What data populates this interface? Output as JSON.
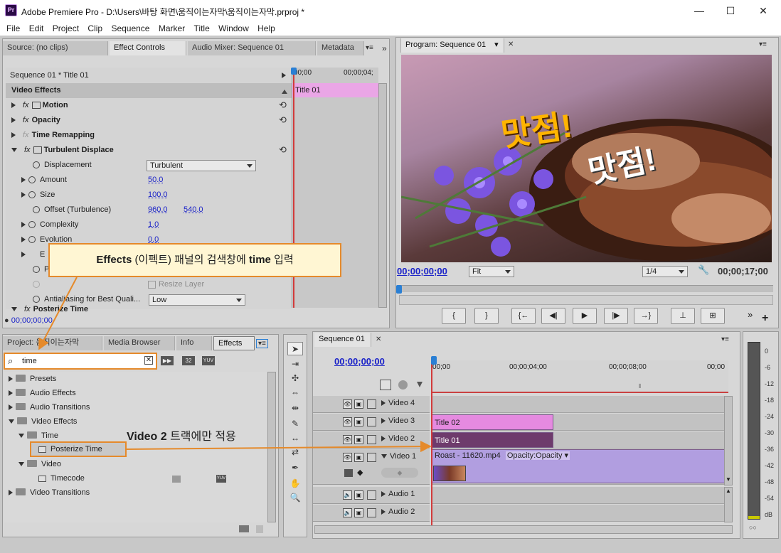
{
  "window": {
    "title": "Adobe Premiere Pro - D:\\Users\\바탕 화면\\움직이는자막\\움직이는자막.prproj *",
    "icon_text": "Pr",
    "minimize": "—",
    "maximize": "☐",
    "close": "✕"
  },
  "menu": [
    "File",
    "Edit",
    "Project",
    "Clip",
    "Sequence",
    "Marker",
    "Title",
    "Window",
    "Help"
  ],
  "top_left_panel": {
    "tabs": [
      "Source: (no clips)",
      "Effect Controls",
      "Audio Mixer: Sequence 01",
      "Metadata"
    ],
    "menu_glyph": "▾≡",
    "overflow_glyph": "»",
    "sequence_label": "Sequence 01 * Title 01",
    "timecode_start": "00;00",
    "timecode_end": "00;00;04;",
    "clip_label": "Title 01",
    "video_effects_header": "Video Effects",
    "fx_glyph": "fx",
    "reset_glyph": "⟲",
    "effects": [
      {
        "name": "Motion"
      },
      {
        "name": "Opacity"
      },
      {
        "name": "Time Remapping"
      },
      {
        "name": "Turbulent Displace"
      }
    ],
    "params": {
      "displacement_label": "Displacement",
      "displacement_value": "Turbulent",
      "amount_label": "Amount",
      "amount_value": "50.0",
      "size_label": "Size",
      "size_value": "100.0",
      "offset_label": "Offset (Turbulence)",
      "offset_x": "960.0",
      "offset_y": "540.0",
      "complexity_label": "Complexity",
      "complexity_value": "1.0",
      "evolution_label": "Evolution",
      "evolution_value": "0.0",
      "e_stub": "E",
      "p_stub": "P",
      "resize_layer": "Resize Layer",
      "antialiasing_label": "Antialiasing for Best Quali...",
      "antialiasing_value": "Low"
    },
    "posterize_label": "Posterize Time",
    "footer_timecode": "00;00;00;00"
  },
  "program_monitor": {
    "tab": "Program: Sequence 01",
    "tab_dropdown": "▾",
    "tab_close": "✕",
    "menu_glyph": "▾≡",
    "overlay_text_1": "맛점!",
    "overlay_text_2": "맛점!",
    "timecode_current": "00;00;00;00",
    "fit": "Fit",
    "resolution": "1/4",
    "wrench": "🔧",
    "timecode_duration": "00;00;17;00",
    "buttons": [
      "{",
      "}",
      "{←",
      "◀|",
      "▶",
      "|▶",
      "→}",
      "⊥",
      "⊞"
    ],
    "extra_glyph": "»",
    "add_glyph": "+"
  },
  "effects_panel": {
    "tabs": [
      "Project: 움직이는자막",
      "Media Browser",
      "Info",
      "Effects"
    ],
    "menu_glyph": "▾≡",
    "search_icon_glyph": "⌕",
    "clear_glyph": "✕",
    "search_value": "time",
    "badges": [
      "32",
      "YUV"
    ],
    "tree": [
      {
        "label": "Presets",
        "level": 0,
        "expanded": false
      },
      {
        "label": "Audio Effects",
        "level": 0,
        "expanded": false
      },
      {
        "label": "Audio Transitions",
        "level": 0,
        "expanded": false
      },
      {
        "label": "Video Effects",
        "level": 0,
        "expanded": true
      },
      {
        "label": "Time",
        "level": 1,
        "expanded": true
      },
      {
        "label": "Posterize Time",
        "level": 2,
        "expanded": false
      },
      {
        "label": "Video",
        "level": 1,
        "expanded": true
      },
      {
        "label": "Timecode",
        "level": 2,
        "expanded": false
      },
      {
        "label": "Video Transitions",
        "level": 0,
        "expanded": false
      }
    ],
    "timecode_badge": "YUV"
  },
  "callouts": {
    "top_bold": "Effects",
    "top_rest": " (이펙트) 패널의 검색창에 ",
    "top_bold2": "time",
    "top_end": " 입력",
    "track_bold": "Video 2",
    "track_rest": " 트랙에만 적용"
  },
  "sequence": {
    "tab": "Sequence 01",
    "tab_close": "✕",
    "menu_glyph": "▾≡",
    "timecode": "00;00;00;00",
    "ruler": [
      "00;00",
      "00;00;04;00",
      "00;00;08;00",
      "00;00"
    ],
    "ruler_mark": "⦀",
    "tracks": [
      {
        "name": "Video 4"
      },
      {
        "name": "Video 3"
      },
      {
        "name": "Video 2"
      },
      {
        "name": "Video 1"
      },
      {
        "name": "Audio 1"
      },
      {
        "name": "Audio 2"
      }
    ],
    "video_header_glyphs": {
      "eye": "👁",
      "film": "▣",
      "lock": ""
    },
    "audio_header_glyphs": {
      "speaker": "🔈",
      "film": "▣",
      "lock": ""
    },
    "clips": {
      "title02": "Title 02",
      "title01": "Title 01",
      "roast": "Roast - 11620.mp4",
      "roast_fx": "Opacity:Opacity ▾"
    },
    "keyframe_glyph": "◆",
    "scroll_up": "▲",
    "scroll_down": "▼"
  },
  "tools": [
    "➤",
    "⇥",
    "✣",
    "⇔",
    "⇹",
    "✎",
    "↔",
    "⇄",
    "✒",
    "✋",
    "🔍"
  ],
  "meters": {
    "labels": [
      "0",
      "-6",
      "-12",
      "-18",
      "-24",
      "-30",
      "-36",
      "-42",
      "-48",
      "-54",
      "dB"
    ],
    "footer": "○○"
  },
  "colors": {
    "accent": "#e58a2b",
    "playhead": "#d23b3b",
    "clip_pink": "#e58ae0",
    "clip_purple": "#b19ee0",
    "timecode_blue": "#1a22c8"
  }
}
